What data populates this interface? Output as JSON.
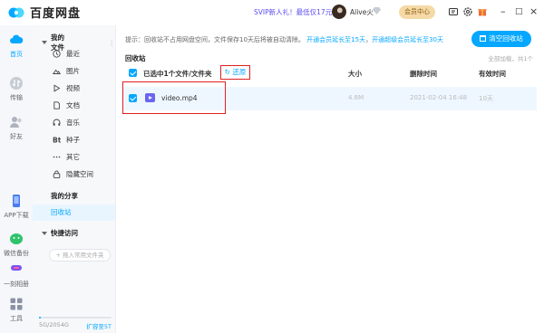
{
  "app": {
    "logo_text": "百度网盘",
    "promo": "SVIP新人礼！最低仅17元",
    "user_name": "Alive火",
    "member_label": "会员中心",
    "accent": "#06a7ff"
  },
  "rail": [
    {
      "label": "首页",
      "icon": "cloud-icon",
      "active": true
    },
    {
      "label": "传输",
      "icon": "transfer-icon"
    },
    {
      "label": "好友",
      "icon": "friends-icon"
    },
    {
      "label": "APP下载",
      "icon": "phone-icon"
    },
    {
      "label": "微信备份",
      "icon": "wechat-icon"
    },
    {
      "label": "一刻相册",
      "icon": "album-icon"
    },
    {
      "label": "工具",
      "icon": "tools-icon"
    }
  ],
  "nav": {
    "my_files": "我的文件",
    "items": [
      "最近",
      "图片",
      "视频",
      "文档",
      "音乐",
      "种子",
      "其它",
      "隐藏空间"
    ],
    "my_share": "我的分享",
    "recycle": "回收站",
    "quick_access": "快捷访问",
    "add_common": "+ 拖入常用文件夹",
    "storage_used": "5G/2054G",
    "storage_fraction": 0.0024,
    "expand": "扩容至5T"
  },
  "main": {
    "notice_prefix": "提示：回收站不占用网盘空间，文件保存10天后将被自动清除。",
    "notice_link1": "开通会员延长至15天",
    "notice_sep": "，",
    "notice_link2": "开通超级会员延长至30天",
    "clear_label": "清空回收站",
    "title": "回收站",
    "loaded": "全部加载，共1个",
    "selected_text": "已选中1个文件/文件夹",
    "restore_label": "还原",
    "columns": {
      "size": "大小",
      "deleted": "删除时间",
      "valid": "有效时间"
    },
    "file": {
      "name": "video.mp4",
      "size": "4.8M",
      "deleted": "2021-02-04 16:48",
      "valid": "10天"
    }
  }
}
